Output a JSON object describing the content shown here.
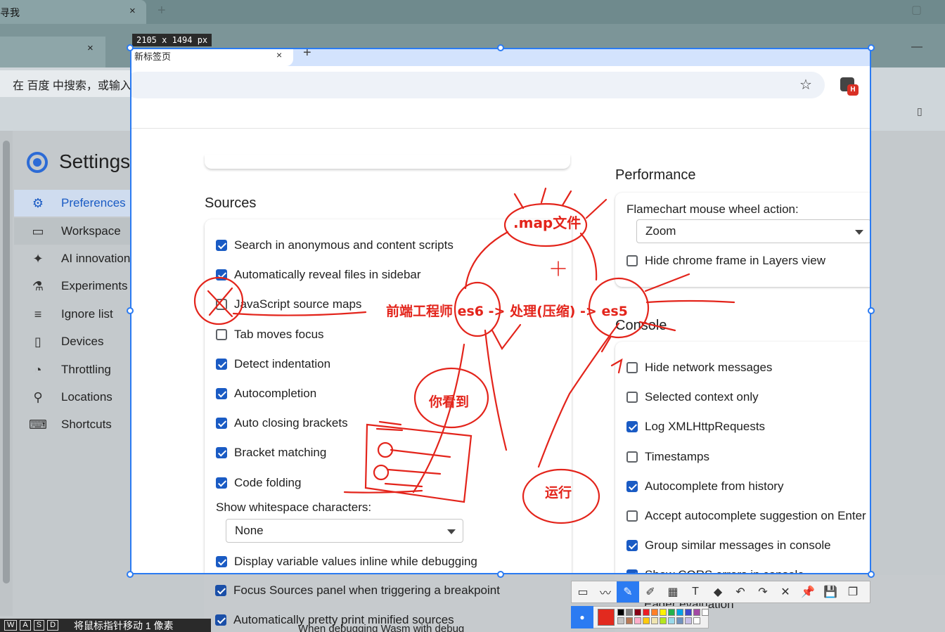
{
  "outer": {
    "tab_title": "寻我",
    "tab_close": "×",
    "new_tab": "+",
    "win_min": "—"
  },
  "shot_browser": {
    "tab_title": "新标签页",
    "tab_close": "×",
    "new_tab": "+",
    "omnibox_text": "在 百度 中搜索，或输入网址",
    "ext_badge": "H",
    "size_tag": "2105 x 1494  px"
  },
  "settings": {
    "title": "Settings",
    "nav": [
      {
        "label": "Preferences",
        "icon": "⚙"
      },
      {
        "label": "Workspace",
        "icon": "▭"
      },
      {
        "label": "AI innovations",
        "icon": "✦"
      },
      {
        "label": "Experiments",
        "icon": "⚗"
      },
      {
        "label": "Ignore list",
        "icon": "≡"
      },
      {
        "label": "Devices",
        "icon": "▯"
      },
      {
        "label": "Throttling",
        "icon": "◔"
      },
      {
        "label": "Locations",
        "icon": "⚲"
      },
      {
        "label": "Shortcuts",
        "icon": "⌨"
      }
    ]
  },
  "sources": {
    "title": "Sources",
    "items": [
      {
        "label": "Search in anonymous and content scripts",
        "checked": true
      },
      {
        "label": "Automatically reveal files in sidebar",
        "checked": true
      },
      {
        "label": "JavaScript source maps",
        "checked": false
      },
      {
        "label": "Tab moves focus",
        "checked": false
      },
      {
        "label": "Detect indentation",
        "checked": true
      },
      {
        "label": "Autocompletion",
        "checked": true
      },
      {
        "label": "Auto closing brackets",
        "checked": true
      },
      {
        "label": "Bracket matching",
        "checked": true
      },
      {
        "label": "Code folding",
        "checked": true
      }
    ],
    "whitespace_label": "Show whitespace characters:",
    "whitespace_value": "None",
    "items_after": [
      {
        "label": "Display variable values inline while debugging",
        "checked": true
      },
      {
        "label": "Focus Sources panel when triggering a breakpoint",
        "checked": true
      },
      {
        "label": "Automatically pretty print minified sources",
        "checked": true
      }
    ],
    "cut_line": "When debugging Wasm with debug"
  },
  "performance": {
    "title": "Performance",
    "flamechart_label": "Flamechart mouse wheel action:",
    "flamechart_value": "Zoom",
    "items": [
      {
        "label": "Hide chrome frame in Layers view",
        "checked": false
      }
    ]
  },
  "console": {
    "title": "Console",
    "items": [
      {
        "label": "Hide network messages",
        "checked": false
      },
      {
        "label": "Selected context only",
        "checked": false
      },
      {
        "label": "Log XMLHttpRequests",
        "checked": true
      },
      {
        "label": "Timestamps",
        "checked": false
      },
      {
        "label": "Autocomplete from history",
        "checked": true
      },
      {
        "label": "Accept autocomplete suggestion on Enter",
        "checked": false
      },
      {
        "label": "Group similar messages in console",
        "checked": true
      },
      {
        "label": "Show CORS errors in console",
        "checked": true
      }
    ],
    "cut_line": "Eager evaluation"
  },
  "annotations": {
    "map_file": ".map文件",
    "flow": "前端工程师 es6 -> 处理(压缩) -> es5",
    "you_see": "你看到",
    "run": "运行"
  },
  "snip_toolbar": {
    "tools": [
      "rect-tool",
      "line-tool",
      "pen-tool",
      "marker-tool",
      "mosaic-tool",
      "text-tool",
      "eraser-tool",
      "undo",
      "redo",
      "cancel",
      "pin",
      "save",
      "copy"
    ],
    "glyphs": [
      "▭",
      "〰",
      "✎",
      "✐",
      "▦",
      "T",
      "◆",
      "↶",
      "↷",
      "✕",
      "📌",
      "💾",
      "❐"
    ],
    "selected_color": "#e22a1f",
    "palette": [
      "#000000",
      "#7f7f7f",
      "#880015",
      "#ed1c24",
      "#ff7f27",
      "#fff200",
      "#22b14c",
      "#00a2e8",
      "#3f48cc",
      "#a349a4",
      "#ffffff",
      "#c3c3c3",
      "#b97a57",
      "#ffaec9",
      "#ffc90e",
      "#efe4b0",
      "#b5e61d",
      "#99d9ea",
      "#7092be",
      "#c8bfe7",
      "#ffffff"
    ]
  },
  "bottom_bar": {
    "keys": [
      "W",
      "A",
      "S",
      "D"
    ],
    "hint": "将鼠标指针移动 1 像素"
  },
  "accent": "#1a5bc4",
  "annotation_color": "#e3241b"
}
